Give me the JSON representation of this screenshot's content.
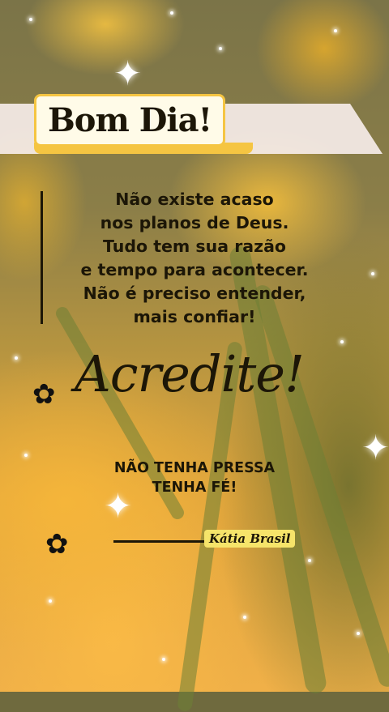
{
  "greeting": "Bom Dia!",
  "quote_lines": [
    "Não existe acaso",
    "nos planos de Deus.",
    "Tudo tem sua razão",
    "e tempo para acontecer.",
    "Não é preciso entender,",
    "mais confiar!"
  ],
  "headline": "Acredite!",
  "faith_lines": [
    "NÃO TENHA PRESSA",
    "TENHA FÉ!"
  ],
  "signature": "Kátia Brasil",
  "decor": {
    "background": "yellow daffodil flowers with green stems",
    "accent_color": "#f5c542",
    "text_color": "#1c1607",
    "icons": [
      "flower-icon",
      "sparkle-icon"
    ]
  }
}
